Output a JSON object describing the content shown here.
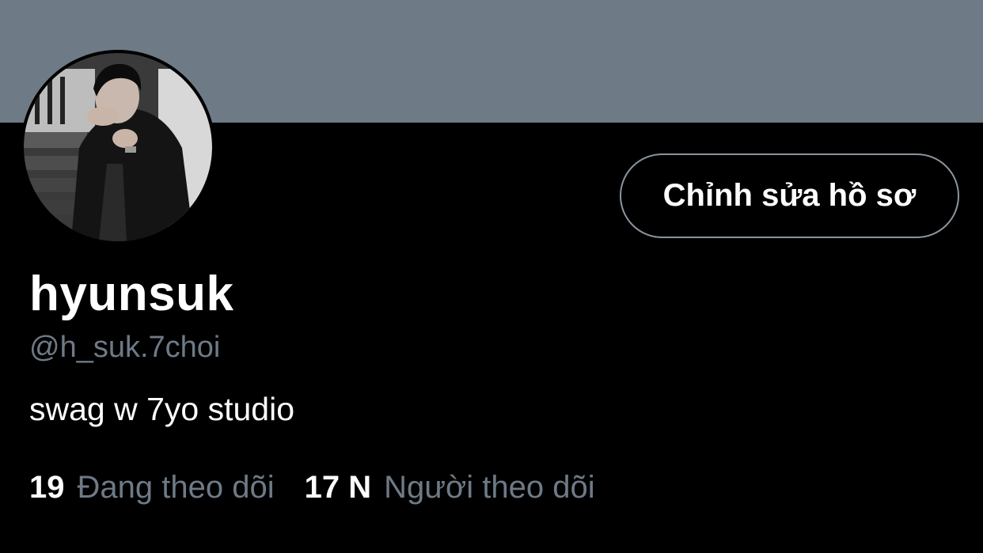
{
  "profile": {
    "display_name": "hyunsuk",
    "handle": "@h_suk.7choi",
    "bio": "swag w 7yo studio",
    "edit_button_label": "Chỉnh sửa hồ sơ",
    "avatar_icon": "profile-photo"
  },
  "stats": {
    "following": {
      "count": "19",
      "label": "Đang theo dõi"
    },
    "followers": {
      "count": "17 N",
      "label": "Người theo dõi"
    }
  },
  "colors": {
    "banner": "#6e7a86",
    "background": "#000000",
    "secondary_text": "#6e7a86",
    "button_border": "#8a949e"
  }
}
